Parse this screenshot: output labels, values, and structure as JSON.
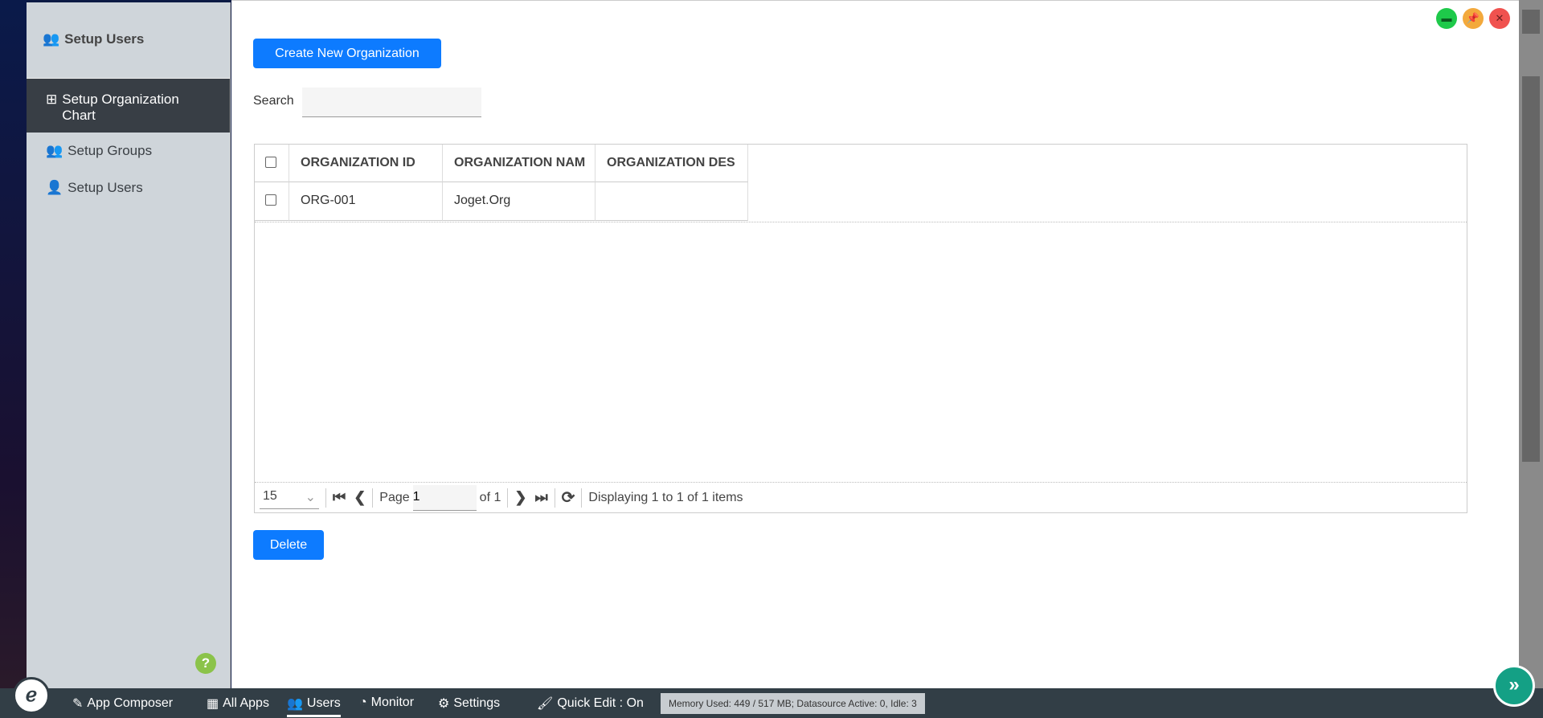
{
  "sidebar": {
    "title": "Setup Users",
    "items": [
      {
        "label": "Setup Organization Chart",
        "active": true
      },
      {
        "label": "Setup Groups"
      },
      {
        "label": "Setup Users"
      }
    ],
    "help": "?"
  },
  "main": {
    "create_label": "Create New Organization",
    "search_label": "Search",
    "search_value": "",
    "delete_label": "Delete"
  },
  "table": {
    "columns": [
      "ORGANIZATION ID",
      "ORGANIZATION NAM",
      "ORGANIZATION DES"
    ],
    "rows": [
      [
        "ORG-001",
        "Joget.Org",
        ""
      ]
    ]
  },
  "pager": {
    "page_size": "15",
    "page_label": "Page",
    "page": "1",
    "of_label": "of 1",
    "status": "Displaying 1 to 1 of 1 items"
  },
  "bottombar": {
    "app_composer": "App Composer",
    "all_apps": "All Apps",
    "users": "Users",
    "monitor": "Monitor",
    "settings": "Settings",
    "quick_edit": "Quick Edit : On",
    "memory": "Memory Used: 449 / 517 MB; Datasource Active: 0, Idle: 3"
  },
  "colors": {
    "primary": "#0d7bff",
    "sidebar_active": "#383e45",
    "bar": "#323e46"
  }
}
